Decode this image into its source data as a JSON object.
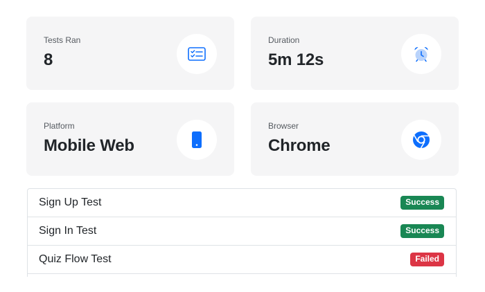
{
  "stats": [
    {
      "label": "Tests Ran",
      "value": "8",
      "icon": "checklist-icon"
    },
    {
      "label": "Duration",
      "value": "5m 12s",
      "icon": "alarm-clock-icon"
    },
    {
      "label": "Platform",
      "value": "Mobile Web",
      "icon": "smartphone-icon"
    },
    {
      "label": "Browser",
      "value": "Chrome",
      "icon": "chrome-icon"
    }
  ],
  "tests": [
    {
      "name": "Sign Up Test",
      "status": "Success"
    },
    {
      "name": "Sign In Test",
      "status": "Success"
    },
    {
      "name": "Quiz Flow Test",
      "status": "Failed"
    }
  ],
  "colors": {
    "accent": "#0d6efd",
    "success": "#198754",
    "failed": "#dc3545",
    "card_bg": "#f5f5f6"
  }
}
